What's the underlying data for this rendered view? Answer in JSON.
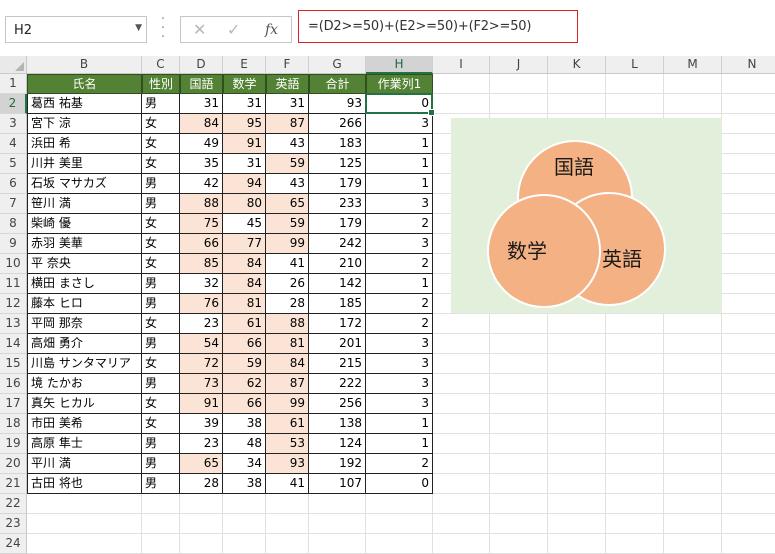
{
  "name_box": {
    "value": "H2"
  },
  "formula_bar": {
    "cancel_icon": "✕",
    "enter_icon": "✓",
    "fx_icon": "fx",
    "formula": "=(D2>=50)+(E2>=50)+(F2>=50)"
  },
  "columns": [
    "B",
    "C",
    "D",
    "E",
    "F",
    "G",
    "H",
    "I",
    "J",
    "K",
    "L",
    "M",
    "N"
  ],
  "selected_column": "H",
  "row_numbers": [
    "1",
    "2",
    "3",
    "4",
    "5",
    "6",
    "7",
    "8",
    "9",
    "10",
    "11",
    "12",
    "13",
    "14",
    "15",
    "16",
    "17",
    "18",
    "19",
    "20",
    "21",
    "22",
    "23",
    "24"
  ],
  "selected_row": "2",
  "table": {
    "headers": [
      "氏名",
      "性別",
      "国語",
      "数学",
      "英語",
      "合計",
      "作業列1"
    ],
    "rows": [
      [
        "葛西 祐基",
        "男",
        "31",
        "31",
        "31",
        "93",
        "0"
      ],
      [
        "宮下 涼",
        "女",
        "84",
        "95",
        "87",
        "266",
        "3"
      ],
      [
        "浜田 希",
        "女",
        "49",
        "91",
        "43",
        "183",
        "1"
      ],
      [
        "川井 美里",
        "女",
        "35",
        "31",
        "59",
        "125",
        "1"
      ],
      [
        "石坂 マサカズ",
        "男",
        "42",
        "94",
        "43",
        "179",
        "1"
      ],
      [
        "笹川 満",
        "男",
        "88",
        "80",
        "65",
        "233",
        "3"
      ],
      [
        "柴崎 優",
        "女",
        "75",
        "45",
        "59",
        "179",
        "2"
      ],
      [
        "赤羽 美華",
        "女",
        "66",
        "77",
        "99",
        "242",
        "3"
      ],
      [
        "平 奈央",
        "女",
        "85",
        "84",
        "41",
        "210",
        "2"
      ],
      [
        "横田 まさし",
        "男",
        "32",
        "84",
        "26",
        "142",
        "1"
      ],
      [
        "藤本 ヒロ",
        "男",
        "76",
        "81",
        "28",
        "185",
        "2"
      ],
      [
        "平岡 那奈",
        "女",
        "23",
        "61",
        "88",
        "172",
        "2"
      ],
      [
        "高畑 勇介",
        "男",
        "54",
        "66",
        "81",
        "201",
        "3"
      ],
      [
        "川島 サンタマリア",
        "女",
        "72",
        "59",
        "84",
        "215",
        "3"
      ],
      [
        "境 たかお",
        "男",
        "73",
        "62",
        "87",
        "222",
        "3"
      ],
      [
        "真矢 ヒカル",
        "女",
        "91",
        "66",
        "99",
        "256",
        "3"
      ],
      [
        "市田 美希",
        "女",
        "39",
        "38",
        "61",
        "138",
        "1"
      ],
      [
        "高原 隼士",
        "男",
        "23",
        "48",
        "53",
        "124",
        "1"
      ],
      [
        "平川 満",
        "男",
        "65",
        "34",
        "93",
        "192",
        "2"
      ],
      [
        "古田 将也",
        "男",
        "28",
        "38",
        "41",
        "107",
        "0"
      ]
    ]
  },
  "venn": {
    "labels": {
      "kokugo": "国語",
      "sugaku": "数学",
      "eigo": "英語"
    },
    "circle_color": "#f4b183",
    "background": "#e2efda"
  }
}
